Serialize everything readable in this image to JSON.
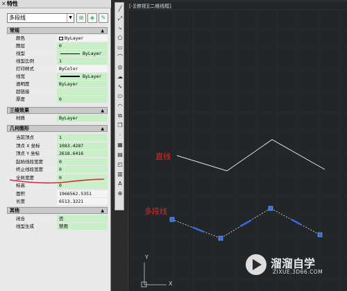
{
  "palette": {
    "title": "特性",
    "selected_object": "多段线",
    "sections": {
      "general": "常规",
      "3d": "三维效果",
      "geometry": "几何图形",
      "misc": "其他"
    },
    "general_rows": [
      {
        "k": "颜色",
        "v": "ByLayer"
      },
      {
        "k": "图层",
        "v": "0"
      },
      {
        "k": "线型",
        "v": "ByLayer"
      },
      {
        "k": "线型比例",
        "v": "1"
      },
      {
        "k": "打印样式",
        "v": "ByColor"
      },
      {
        "k": "线宽",
        "v": "ByLayer"
      },
      {
        "k": "透明度",
        "v": "ByLayer"
      },
      {
        "k": "超链接",
        "v": ""
      },
      {
        "k": "厚度",
        "v": "0"
      }
    ],
    "three_d_rows": [
      {
        "k": "材质",
        "v": "ByLayer"
      }
    ],
    "geometry_rows": [
      {
        "k": "当前顶点",
        "v": "1"
      },
      {
        "k": "顶点 X 坐标",
        "v": "1083.4287"
      },
      {
        "k": "顶点 Y 坐标",
        "v": "2618.6416"
      },
      {
        "k": "起始线段宽度",
        "v": "0"
      },
      {
        "k": "终止线段宽度",
        "v": "0"
      },
      {
        "k": "全局宽度",
        "v": "0"
      },
      {
        "k": "标高",
        "v": "0"
      },
      {
        "k": "面积",
        "v": "1966562.5351"
      },
      {
        "k": "长度",
        "v": "6513.3221"
      }
    ],
    "misc_rows": [
      {
        "k": "闭合",
        "v": "否"
      },
      {
        "k": "线型生成",
        "v": "禁用"
      }
    ]
  },
  "viewport": {
    "label": "[-][俯视][二维线框]",
    "annotation_line": "直线",
    "annotation_polyline": "多段线",
    "ucs_y": "Y",
    "ucs_x": "X"
  },
  "watermark": {
    "title": "溜溜自学",
    "url": "ZIXUE.3D66.COM"
  },
  "colors": {
    "value_bg": "#c9efc9",
    "annotation_red": "#d62b2b",
    "grip_blue": "#2f6fe0",
    "canvas_bg": "#232629"
  }
}
